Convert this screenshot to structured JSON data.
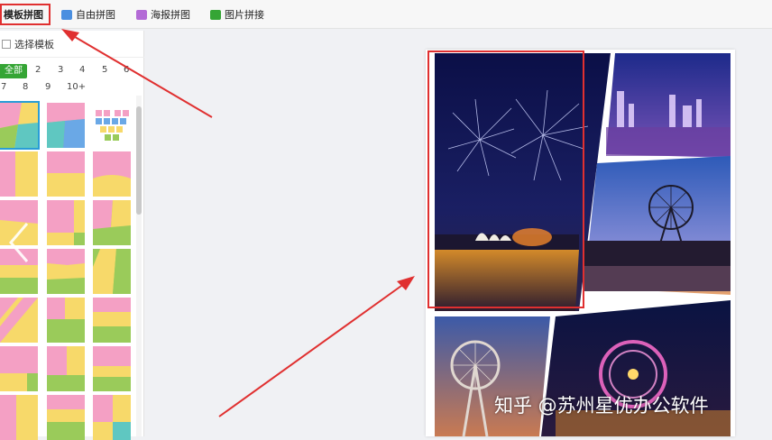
{
  "toolbar": {
    "tabs": [
      {
        "label": "模板拼图",
        "icon": "template-collage-icon",
        "color": "#3a7fd5",
        "active": true
      },
      {
        "label": "自由拼图",
        "icon": "free-collage-icon",
        "color": "#4a8fe0",
        "active": false
      },
      {
        "label": "海报拼图",
        "icon": "poster-collage-icon",
        "color": "#b36ad6",
        "active": false
      },
      {
        "label": "图片拼接",
        "icon": "image-stitch-icon",
        "color": "#35a535",
        "active": false
      }
    ]
  },
  "panel": {
    "title": "选择模板",
    "filters": [
      "全部",
      "2",
      "3",
      "4",
      "5",
      "6",
      "7",
      "8",
      "9",
      "10+"
    ],
    "selected_filter": "全部"
  },
  "watermark": "知乎 @苏州星优办公软件",
  "colors": {
    "accent_green": "#35a535",
    "highlight_red": "#e03030",
    "thumb_pink": "#f4a0c4",
    "thumb_yellow": "#f7d96a",
    "thumb_green": "#9acb5a",
    "thumb_teal": "#5fc7c1",
    "thumb_blue": "#6aa8e6"
  }
}
